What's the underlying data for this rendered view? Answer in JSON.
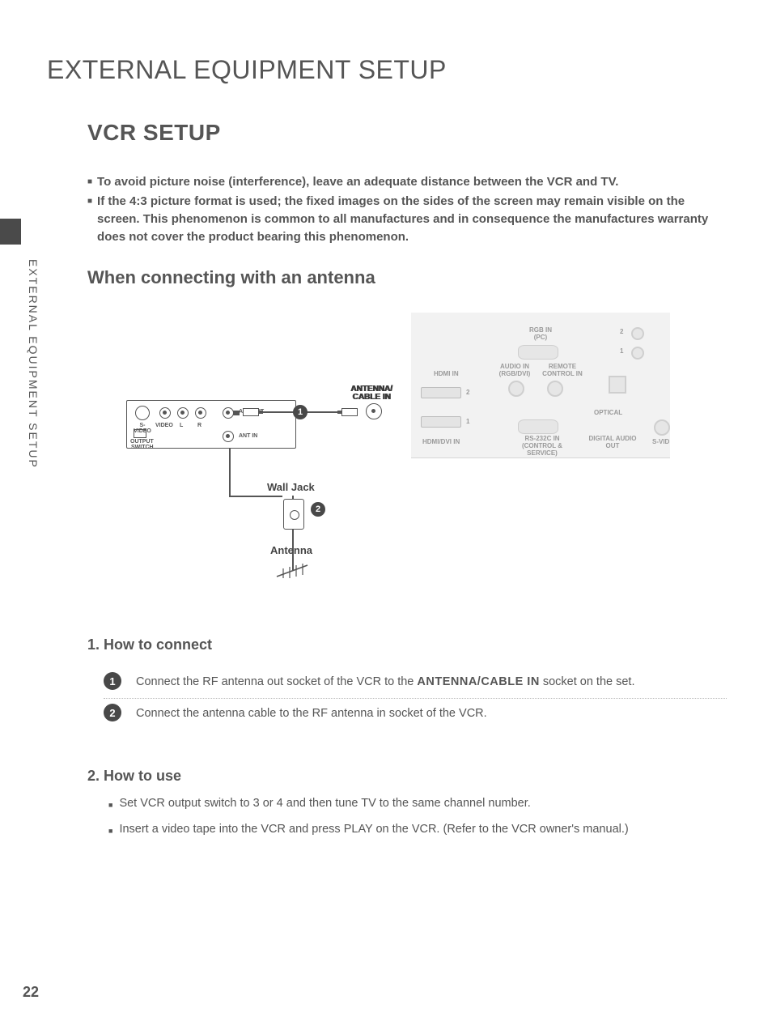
{
  "page": {
    "title": "EXTERNAL EQUIPMENT SETUP",
    "vertical_label": "EXTERNAL EQUIPMENT SETUP",
    "number": "22"
  },
  "section": {
    "title": "VCR SETUP"
  },
  "intro": {
    "b1": "To avoid picture noise (interference), leave an adequate distance between the VCR and TV.",
    "b2": "If the 4:3 picture format is used; the fixed images on the sides of the screen may remain visible on the screen. This phenomenon is common to all manufactures and in consequence the manufactures warranty does not cover the product bearing this phenomenon."
  },
  "subsection": {
    "title": "When connecting with an antenna"
  },
  "diagram": {
    "vcr": {
      "svideo": "S-VIDEO",
      "video": "VIDEO",
      "l": "L",
      "r": "R",
      "ant_out": "ANT OUT",
      "ant_in": "ANT IN",
      "output_switch_top": "OUTPUT",
      "output_switch_bot": "SWITCH"
    },
    "antenna_cable_in_top": "ANTENNA/",
    "antenna_cable_in_bot": "CABLE IN",
    "wall_jack": "Wall Jack",
    "antenna": "Antenna",
    "callout1": "1",
    "callout2": "2",
    "tv": {
      "hdmi_in": "HDMI IN",
      "hdmi_dvi_in": "HDMI/DVI IN",
      "hdmi2": "2",
      "hdmi1": "1",
      "rgb_in": "RGB IN",
      "rgb_pc": "(PC)",
      "audio_in": "AUDIO IN",
      "audio_sub": "(RGB/DVI)",
      "remote": "REMOTE",
      "control_in": "CONTROL IN",
      "rs232": "RS-232C IN",
      "rs232_sub": "(CONTROL & SERVICE)",
      "optical": "OPTICAL",
      "digital_audio": "DIGITAL AUDIO",
      "digital_audio_sub": "OUT",
      "svid": "S-VID",
      "comp2": "2",
      "comp1": "1"
    }
  },
  "howto1": {
    "title": "1. How to connect",
    "steps": [
      {
        "num": "1",
        "pre": "Connect the RF antenna out socket of the VCR to the ",
        "bold": "ANTENNA/CABLE IN",
        "post": " socket on the set."
      },
      {
        "num": "2",
        "pre": "Connect the antenna cable to the RF antenna in socket of the VCR.",
        "bold": "",
        "post": ""
      }
    ]
  },
  "howto2": {
    "title": "2. How to use",
    "items": [
      "Set VCR output switch to 3 or 4 and then tune TV to the same channel number.",
      "Insert a video tape into the VCR and press PLAY on the VCR. (Refer to the VCR owner's manual.)"
    ]
  }
}
